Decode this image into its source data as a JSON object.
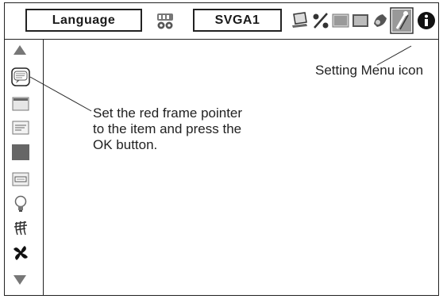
{
  "topbar": {
    "menu_name": "Language",
    "input_source": "SVGA1",
    "icons": [
      "input-select-icon",
      "pc-adjust-icon",
      "image-select-icon",
      "image-adjust-icon",
      "screen-icon",
      "sound-icon",
      "setting-menu-icon",
      "info-icon"
    ]
  },
  "sidebar": {
    "items": [
      "scroll-up-icon",
      "language-icon",
      "menu-position-icon",
      "display-icon",
      "blank-color-icon",
      "logo-icon",
      "lamp-icon",
      "fan-icon",
      "fan-control-icon",
      "scroll-down-icon"
    ]
  },
  "callouts": {
    "setting_menu": "Setting Menu icon",
    "pointer_line1": "Set the red frame pointer",
    "pointer_line2": "to the item and press the",
    "pointer_line3": "OK button."
  },
  "colors": {
    "frame": "#222222",
    "icon_gray": "#888888",
    "icon_dark": "#333333"
  }
}
